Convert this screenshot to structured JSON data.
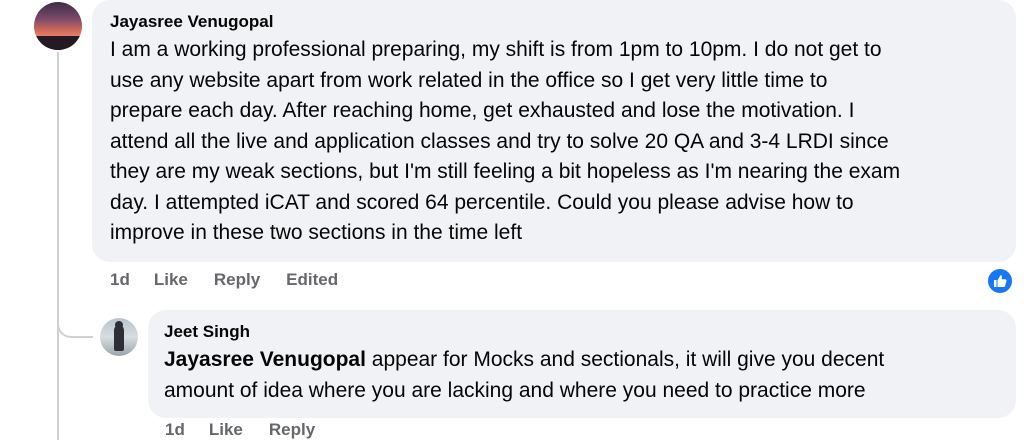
{
  "comment": {
    "author": "Jayasree Venugopal",
    "text_lines": [
      "I am a working professional preparing, my shift is from 1pm to 10pm. I do not get to",
      "use any website apart from work related in the office so I get very little time to",
      "prepare each day. After reaching home, get exhausted and lose the motivation. I",
      "attend all the live and application classes and try to solve 20 QA and 3-4 LRDI since",
      "they are my weak sections, but I'm still feeling a bit hopeless as I'm nearing the exam",
      "day. I attempted iCAT and scored 64 percentile. Could you please advise how to",
      "improve in these two sections in the time left"
    ],
    "time": "1d",
    "like_label": "Like",
    "reply_label": "Reply",
    "edited_label": "Edited",
    "reaction_icon": "thumbs-up-icon",
    "reaction_color": "#1877f2"
  },
  "reply": {
    "author": "Jeet Singh",
    "mention": "Jayasree Venugopal",
    "text_line1_rest": " appear for Mocks and sectionals, it will give you decent",
    "text_line2": "amount of idea where you are lacking and where you need to practice more",
    "time": "1d",
    "like_label": "Like",
    "reply_label": "Reply"
  }
}
